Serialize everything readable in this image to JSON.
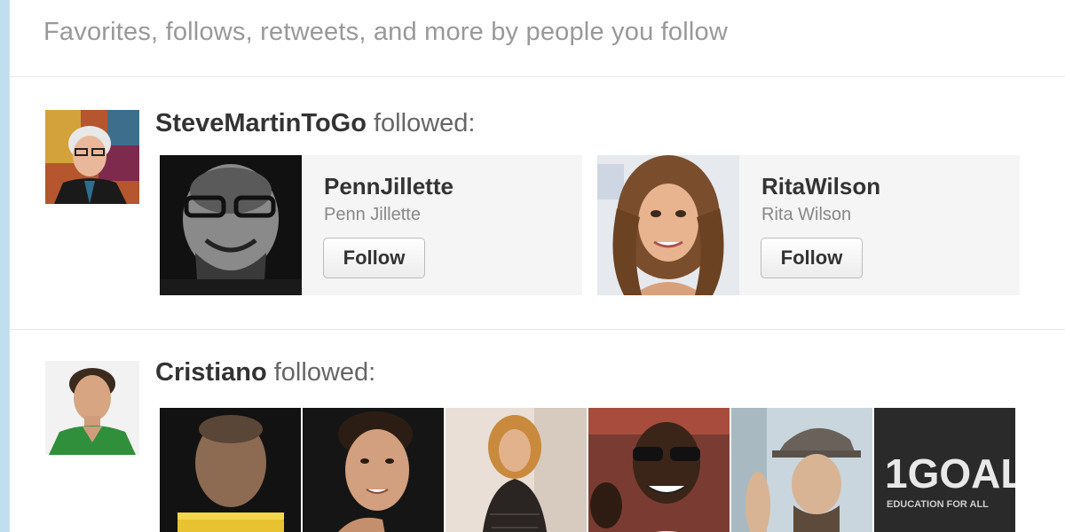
{
  "header": {
    "text": "Favorites, follows, retweets, and more by people you follow"
  },
  "activities": [
    {
      "actor": "SteveMartinToGo",
      "verb": "followed:",
      "targets": [
        {
          "name": "PennJillette",
          "handle": "Penn Jillette",
          "button": "Follow"
        },
        {
          "name": "RitaWilson",
          "handle": "Rita Wilson",
          "button": "Follow"
        }
      ]
    },
    {
      "actor": "Cristiano",
      "verb": "followed:",
      "thumbnail_text": {
        "logo_main": "1GOAL",
        "logo_sub": "EDUCATION FOR ALL"
      }
    }
  ],
  "colors": {
    "page_background": "#c0deed",
    "panel_background": "#ffffff",
    "card_background": "#f5f5f5",
    "muted_text": "#999999"
  }
}
